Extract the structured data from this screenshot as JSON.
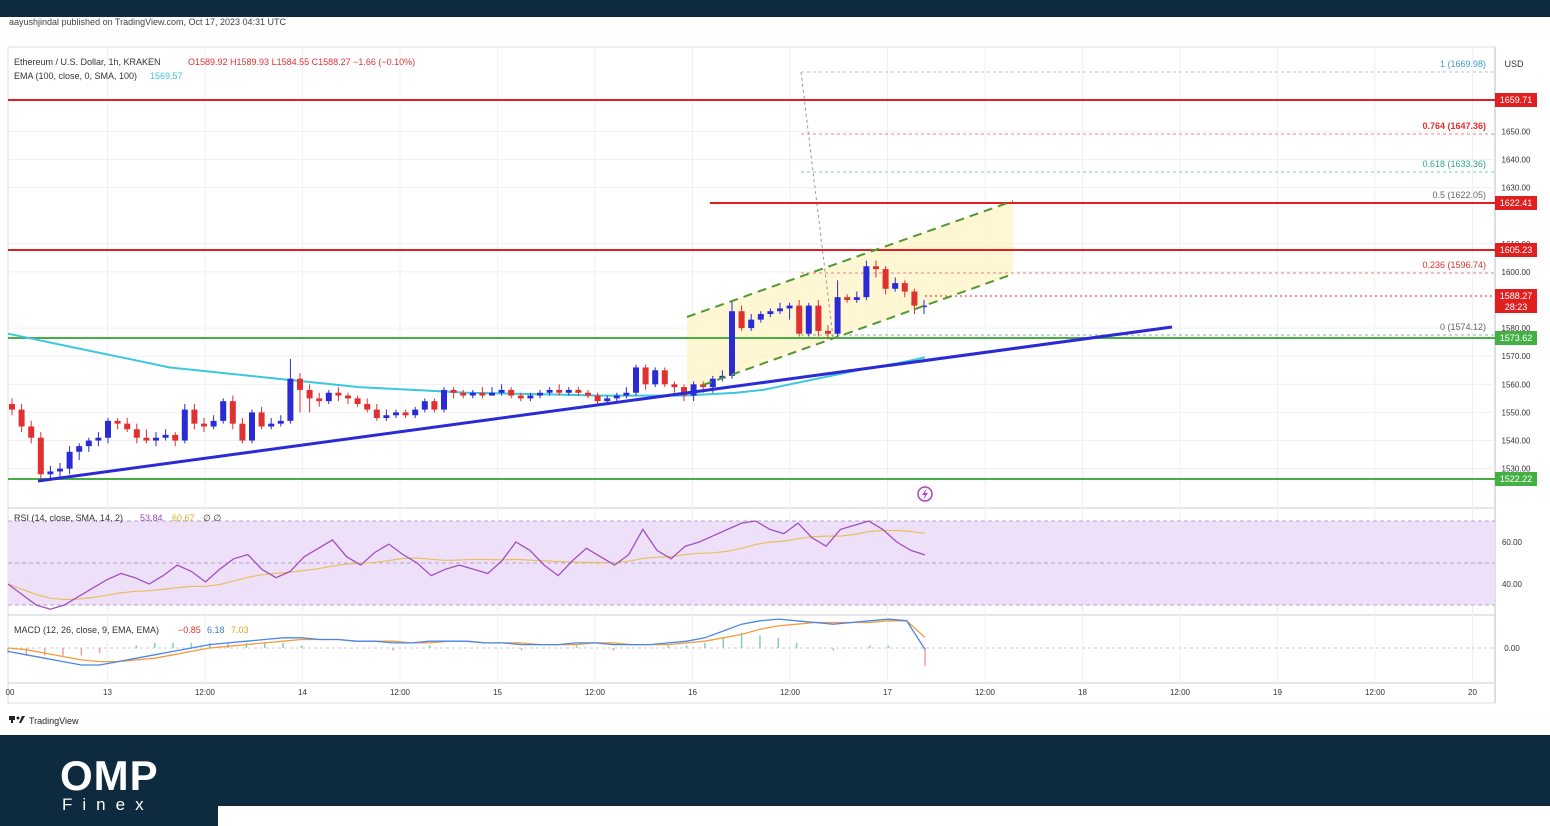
{
  "publisher": "aayushjindal published on TradingView.com, Oct 17, 2023 04:31 UTC",
  "legend": {
    "symbol": "Ethereum / U.S. Dollar, 1h, KRAKEN",
    "ohlc": "O1589.92  H1589.93  L1584.55  C1588.27  −1.66 (−0.10%)",
    "ema_label": "EMA (100, close, 0, SMA, 100)",
    "ema_value": "1569.57",
    "rsi_label": "RSI (14, close, SMA, 14, 2)",
    "rsi_value": "53.84",
    "rsi_ma_value": "60.67",
    "rsi_extra": "∅  ∅",
    "macd_label": "MACD (12, 26, close, 9, EMA, EMA)",
    "macd_value": "−0.85",
    "macd_signal_value": "6.18",
    "macd_hist_value": "7.03"
  },
  "currency": "USD",
  "price_tags": {
    "r1": "1659.71",
    "r2": "1622.41",
    "r3": "1605.23",
    "current": "1588.27",
    "countdown": "28:23",
    "s1": "1573.62",
    "s2": "1522.22"
  },
  "fib_labels": {
    "f100": "1 (1669.98)",
    "f764": "0.764 (1647.36)",
    "f618": "0.618 (1633.36)",
    "f500": "0.5 (1622.05)",
    "f236": "0.236 (1596.74)",
    "f0": "0 (1574.12)"
  },
  "price_axis_ticks": [
    "1650.00",
    "1640.00",
    "1630.00",
    "1610.00",
    "1600.00",
    "1580.00",
    "1570.00",
    "1560.00",
    "1550.00",
    "1540.00",
    "1530.00"
  ],
  "rsi_axis_ticks": [
    "60.00",
    "40.00"
  ],
  "macd_axis_ticks": [
    "0.00"
  ],
  "time_axis_ticks": [
    "00",
    "13",
    "12:00",
    "14",
    "12:00",
    "15",
    "12:00",
    "16",
    "12:00",
    "17",
    "12:00",
    "18",
    "12:00",
    "19",
    "12:00",
    "20"
  ],
  "footer_brand": "TradingView",
  "logo": {
    "main": "OMP",
    "sub": "Finex"
  },
  "colors": {
    "bull": "#2a2ad6",
    "bear": "#e03030",
    "ema": "#3cc8dc",
    "resistance": "#e02020",
    "support": "#44b044",
    "trendline": "#2a2ad6",
    "channel": "#4f9a2f",
    "rsi": "#b068c8",
    "macd": "#4a86e8",
    "macd_signal": "#f39c40",
    "background_dark": "#0d2a3e"
  },
  "chart_data": {
    "type": "candlestick",
    "symbol": "ETH/USD",
    "interval": "1h",
    "ylim": [
      1516,
      1680
    ],
    "horizontal_levels": {
      "resistance": [
        1659.71,
        1622.41,
        1605.23
      ],
      "support": [
        1573.62,
        1522.22
      ]
    },
    "fibonacci": [
      {
        "level": 1,
        "price": 1669.98
      },
      {
        "level": 0.764,
        "price": 1647.36
      },
      {
        "level": 0.618,
        "price": 1633.36
      },
      {
        "level": 0.5,
        "price": 1622.05
      },
      {
        "level": 0.236,
        "price": 1596.74
      },
      {
        "level": 0,
        "price": 1574.12
      }
    ],
    "candles": [
      [
        1553,
        1551,
        1555,
        1549
      ],
      [
        1551,
        1545,
        1553,
        1543
      ],
      [
        1545,
        1541,
        1547,
        1539
      ],
      [
        1541,
        1528,
        1543,
        1526
      ],
      [
        1528,
        1529,
        1531,
        1526
      ],
      [
        1529,
        1530,
        1532,
        1527
      ],
      [
        1530,
        1536,
        1538,
        1528
      ],
      [
        1536,
        1538,
        1539,
        1533
      ],
      [
        1538,
        1540,
        1541,
        1536
      ],
      [
        1540,
        1541,
        1543,
        1538
      ],
      [
        1541,
        1547,
        1548,
        1539
      ],
      [
        1547,
        1546,
        1548,
        1544
      ],
      [
        1546,
        1544,
        1548,
        1543
      ],
      [
        1544,
        1541,
        1546,
        1539
      ],
      [
        1541,
        1540,
        1544,
        1539
      ],
      [
        1540,
        1541,
        1543,
        1538
      ],
      [
        1541,
        1542,
        1544,
        1540
      ],
      [
        1542,
        1540,
        1543,
        1538
      ],
      [
        1540,
        1551,
        1553,
        1539
      ],
      [
        1551,
        1546,
        1553,
        1544
      ],
      [
        1546,
        1545,
        1548,
        1543
      ],
      [
        1545,
        1547,
        1549,
        1544
      ],
      [
        1547,
        1554,
        1555,
        1546
      ],
      [
        1554,
        1546,
        1556,
        1544
      ],
      [
        1546,
        1540,
        1548,
        1539
      ],
      [
        1540,
        1550,
        1551,
        1539
      ],
      [
        1550,
        1545,
        1552,
        1544
      ],
      [
        1545,
        1546,
        1548,
        1544
      ],
      [
        1546,
        1547,
        1549,
        1545
      ],
      [
        1547,
        1562,
        1569,
        1546
      ],
      [
        1562,
        1558,
        1564,
        1550
      ],
      [
        1558,
        1555,
        1560,
        1550
      ],
      [
        1555,
        1554,
        1557,
        1552
      ],
      [
        1554,
        1557,
        1558,
        1553
      ],
      [
        1557,
        1556,
        1559,
        1554
      ],
      [
        1556,
        1555,
        1557,
        1553
      ],
      [
        1555,
        1553,
        1556,
        1552
      ],
      [
        1553,
        1551,
        1555,
        1550
      ],
      [
        1551,
        1548,
        1553,
        1547
      ],
      [
        1548,
        1549,
        1551,
        1547
      ],
      [
        1549,
        1550,
        1551,
        1548
      ],
      [
        1550,
        1549,
        1551,
        1548
      ],
      [
        1549,
        1551,
        1552,
        1548
      ],
      [
        1551,
        1554,
        1555,
        1550
      ],
      [
        1554,
        1551,
        1555,
        1550
      ],
      [
        1551,
        1558,
        1559,
        1550
      ],
      [
        1558,
        1557,
        1559,
        1555
      ],
      [
        1557,
        1556,
        1558,
        1555
      ],
      [
        1556,
        1557,
        1558,
        1555
      ],
      [
        1557,
        1556,
        1559,
        1555
      ],
      [
        1556,
        1557,
        1559,
        1556
      ],
      [
        1557,
        1558,
        1560,
        1556
      ],
      [
        1558,
        1556,
        1559,
        1555
      ],
      [
        1556,
        1555,
        1557,
        1554
      ],
      [
        1555,
        1556,
        1557,
        1554
      ],
      [
        1556,
        1557,
        1558,
        1555
      ],
      [
        1557,
        1558,
        1559,
        1556
      ],
      [
        1558,
        1557,
        1560,
        1556
      ],
      [
        1557,
        1558,
        1559,
        1556
      ],
      [
        1558,
        1557,
        1559,
        1556
      ],
      [
        1557,
        1556,
        1558,
        1555
      ],
      [
        1556,
        1554,
        1557,
        1553
      ],
      [
        1554,
        1555,
        1556,
        1553
      ],
      [
        1555,
        1556,
        1557,
        1554
      ],
      [
        1556,
        1557,
        1559,
        1555
      ],
      [
        1557,
        1566,
        1567,
        1556
      ],
      [
        1566,
        1560,
        1567,
        1558
      ],
      [
        1560,
        1565,
        1566,
        1559
      ],
      [
        1565,
        1560,
        1566,
        1559
      ],
      [
        1560,
        1559,
        1561,
        1557
      ],
      [
        1559,
        1556,
        1560,
        1554
      ],
      [
        1556,
        1560,
        1561,
        1554
      ],
      [
        1560,
        1559,
        1561,
        1557
      ],
      [
        1559,
        1562,
        1563,
        1557
      ],
      [
        1562,
        1563,
        1565,
        1561
      ],
      [
        1563,
        1586,
        1590,
        1562
      ],
      [
        1586,
        1580,
        1588,
        1579
      ],
      [
        1580,
        1583,
        1585,
        1579
      ],
      [
        1583,
        1585,
        1586,
        1582
      ],
      [
        1585,
        1586,
        1587,
        1584
      ],
      [
        1586,
        1587,
        1589,
        1585
      ],
      [
        1587,
        1588,
        1589,
        1583
      ],
      [
        1588,
        1578,
        1590,
        1577
      ],
      [
        1578,
        1588,
        1589,
        1577
      ],
      [
        1588,
        1579,
        1590,
        1577
      ],
      [
        1579,
        1578,
        1581,
        1576
      ],
      [
        1578,
        1591,
        1597,
        1577
      ],
      [
        1591,
        1590,
        1592,
        1589
      ],
      [
        1590,
        1591,
        1593,
        1589
      ],
      [
        1591,
        1602,
        1604,
        1590
      ],
      [
        1602,
        1601,
        1604,
        1598
      ],
      [
        1601,
        1594,
        1602,
        1592
      ],
      [
        1594,
        1596,
        1598,
        1593
      ],
      [
        1596,
        1593,
        1597,
        1591
      ],
      [
        1593,
        1588,
        1594,
        1585
      ],
      [
        1588,
        1588,
        1590,
        1585
      ]
    ],
    "ema_100": [
      1578,
      1576,
      1574,
      1572,
      1570,
      1568,
      1566,
      1565,
      1564,
      1563,
      1562,
      1561,
      1560,
      1559,
      1558.5,
      1558,
      1557.5,
      1557,
      1556.8,
      1556.6,
      1556.4,
      1556.2,
      1556,
      1556,
      1556,
      1556,
      1556.5,
      1557,
      1558,
      1560,
      1562,
      1564,
      1566,
      1567.5,
      1569.57
    ],
    "rsi": [
      40,
      35,
      30,
      28,
      30,
      34,
      38,
      42,
      45,
      43,
      40,
      44,
      49,
      46,
      41,
      47,
      52,
      54,
      47,
      43,
      46,
      53,
      57,
      61,
      53,
      49,
      55,
      59,
      54,
      50,
      44,
      47,
      49,
      47,
      45,
      51,
      60,
      56,
      49,
      44,
      51,
      57,
      53,
      49,
      54,
      66,
      56,
      52,
      58,
      60,
      63,
      66,
      69,
      70,
      66,
      64,
      69,
      62,
      58,
      66,
      68,
      70,
      66,
      60,
      56,
      53.84
    ],
    "macd": [
      -2,
      -4,
      -6,
      -8,
      -10,
      -10,
      -8,
      -6,
      -4,
      -2,
      0,
      2,
      3,
      4,
      5,
      6,
      6,
      5,
      5,
      4,
      4,
      3,
      3,
      4,
      4,
      4,
      3,
      3,
      2,
      2,
      2,
      3,
      3,
      2,
      2,
      2,
      3,
      4,
      6,
      10,
      14,
      16,
      17,
      16,
      15,
      14,
      15,
      16,
      17,
      16,
      -0.85
    ],
    "macd_signal": [
      0,
      -1,
      -3,
      -5,
      -7,
      -8,
      -8,
      -7,
      -6,
      -4,
      -2,
      0,
      1,
      2,
      3,
      4,
      5,
      5,
      5,
      4,
      4,
      4,
      3,
      3,
      4,
      4,
      3,
      3,
      3,
      2,
      2,
      2,
      3,
      3,
      2,
      2,
      2,
      3,
      4,
      6,
      8,
      11,
      13,
      14,
      15,
      15,
      15,
      15,
      16,
      16,
      6.18
    ]
  }
}
